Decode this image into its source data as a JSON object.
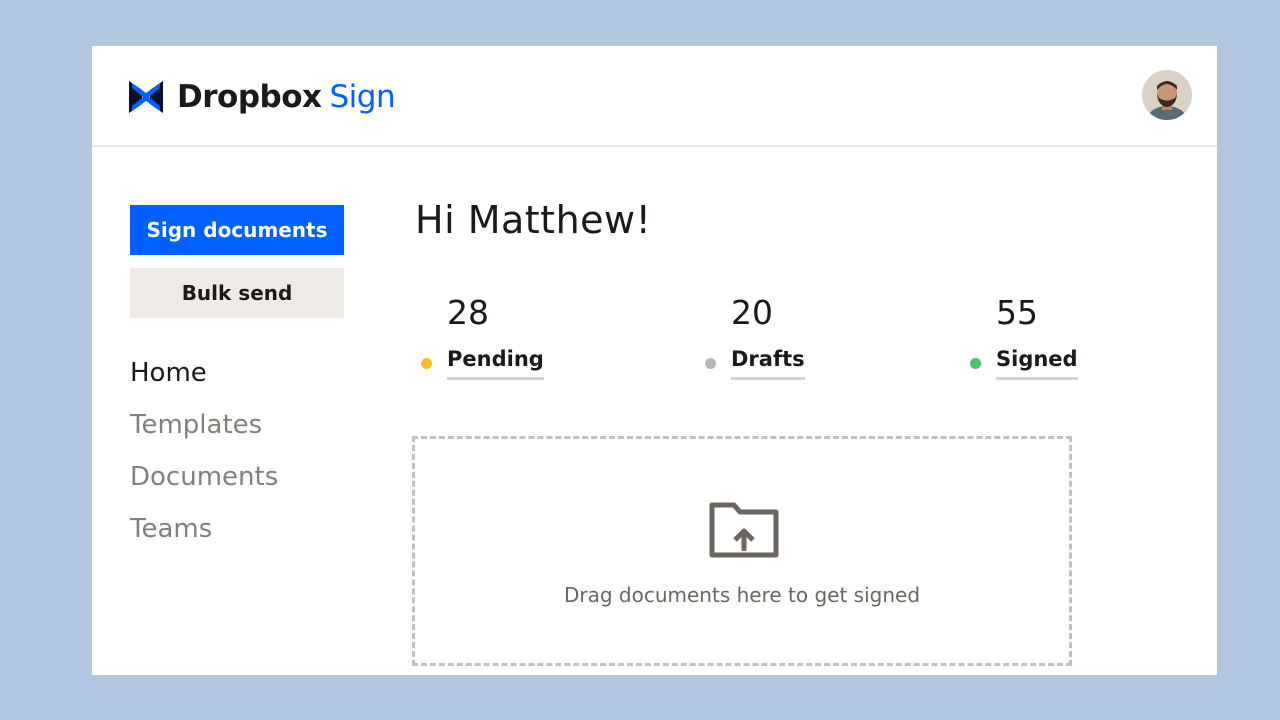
{
  "header": {
    "logo_brand": "Dropbox",
    "logo_product": "Sign"
  },
  "sidebar": {
    "primary_button": "Sign documents",
    "secondary_button": "Bulk send",
    "nav": [
      {
        "label": "Home",
        "active": true
      },
      {
        "label": "Templates",
        "active": false
      },
      {
        "label": "Documents",
        "active": false
      },
      {
        "label": "Teams",
        "active": false
      }
    ]
  },
  "main": {
    "greeting": "Hi Matthew!",
    "stats": [
      {
        "count": "28",
        "label": "Pending",
        "color": "#f9bd2b"
      },
      {
        "count": "20",
        "label": "Drafts",
        "color": "#bab6b1"
      },
      {
        "count": "55",
        "label": "Signed",
        "color": "#45c46b"
      }
    ],
    "dropzone_text": "Drag documents here to get signed"
  },
  "colors": {
    "accent": "#0061fe",
    "backdrop": "#b1c7e2"
  },
  "icons": {
    "logo": "dropbox-sign-logo-icon",
    "dropzone": "folder-upload-icon",
    "user": "user-avatar"
  }
}
